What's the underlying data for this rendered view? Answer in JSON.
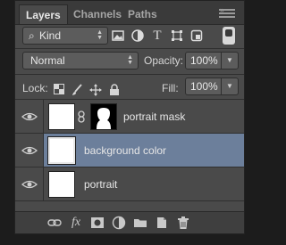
{
  "tabs": [
    {
      "label": "Layers"
    },
    {
      "label": "Channels"
    },
    {
      "label": "Paths"
    }
  ],
  "tab_close": "×",
  "filter": {
    "kind_label": "Kind",
    "icons": [
      "image-filter-icon",
      "adjustment-filter-icon",
      "type-filter-icon",
      "shape-filter-icon",
      "smart-object-filter-icon"
    ],
    "type_glyph": "T"
  },
  "blend": {
    "mode": "Normal",
    "opacity_label": "Opacity:",
    "opacity_value": "100%"
  },
  "lock": {
    "label": "Lock:",
    "fill_label": "Fill:",
    "fill_value": "100%"
  },
  "layers": [
    {
      "name": "portrait mask",
      "visible": true,
      "selected": false,
      "has_mask": true
    },
    {
      "name": "background color",
      "visible": true,
      "selected": true,
      "has_mask": false
    },
    {
      "name": "portrait",
      "visible": true,
      "selected": false,
      "has_mask": false
    }
  ],
  "footer": {
    "fx_label": "fx"
  },
  "colors": {
    "panel_bg": "#4a4a4a",
    "selected_row": "#6c7f9b",
    "tab_bar": "#3a3a3a"
  }
}
